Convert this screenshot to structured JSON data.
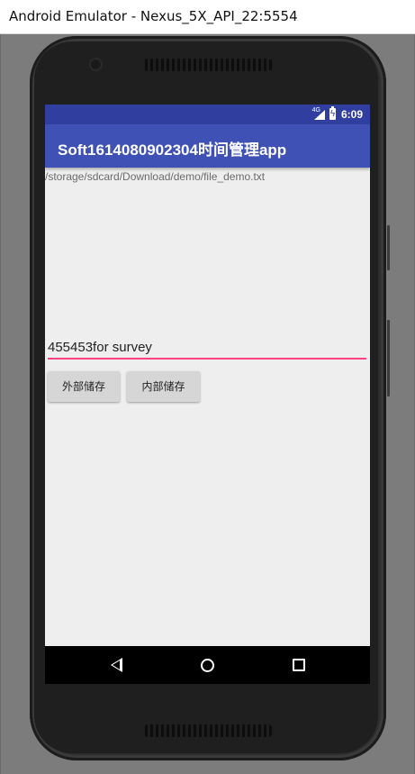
{
  "window": {
    "title": "Android Emulator - Nexus_5X_API_22:5554"
  },
  "status_bar": {
    "network": "4G",
    "time": "6:09"
  },
  "app_bar": {
    "title": "Soft1614080902304时间管理app"
  },
  "content": {
    "file_path": "/storage/sdcard/Download/demo/file_demo.txt",
    "input_value": "455453for survey",
    "buttons": {
      "external_storage": "外部储存",
      "internal_storage": "内部储存"
    }
  },
  "colors": {
    "status_bar": "#303f9f",
    "app_bar": "#3f51b5",
    "accent": "#ff4081",
    "screen_background": "#eeeeee"
  },
  "icons": {
    "signal": "signal-icon",
    "battery": "battery-charging-icon",
    "nav_back": "back-icon",
    "nav_home": "home-icon",
    "nav_recents": "recents-icon"
  }
}
